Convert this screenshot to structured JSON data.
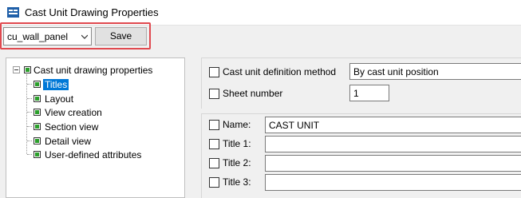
{
  "window": {
    "title": "Cast Unit Drawing Properties",
    "icon": "tekla-app-icon"
  },
  "toolbar": {
    "preset_value": "cu_wall_panel",
    "save_label": "Save",
    "highlight_color": "#e0494f"
  },
  "tree": {
    "root_label": "Cast unit drawing properties",
    "items": [
      "Titles",
      "Layout",
      "View creation",
      "Section view",
      "Detail view",
      "User-defined attributes"
    ],
    "selected": "Titles"
  },
  "props": {
    "definition_method_label": "Cast unit definition method",
    "definition_method_value": "By cast unit position",
    "sheet_number_label": "Sheet number",
    "sheet_number_value": "1",
    "name_label": "Name:",
    "name_value": "CAST UNIT",
    "title1_label": "Title 1:",
    "title2_label": "Title 2:",
    "title3_label": "Title 3:"
  }
}
